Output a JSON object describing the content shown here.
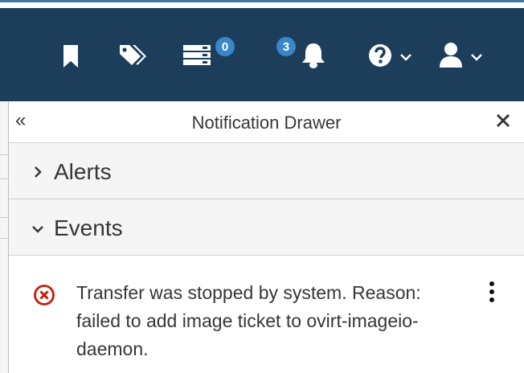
{
  "navbar": {
    "items": [
      {
        "icon": "bookmark-icon"
      },
      {
        "icon": "tags-icon"
      },
      {
        "icon": "tasks-icon",
        "badge": "0"
      },
      {
        "icon": "bell-icon",
        "badge": "3"
      },
      {
        "icon": "help-icon"
      },
      {
        "icon": "user-icon"
      }
    ]
  },
  "drawer": {
    "title": "Notification Drawer",
    "expand_glyph": "«",
    "sections": [
      {
        "label": "Alerts",
        "expanded": false
      },
      {
        "label": "Events",
        "expanded": true
      }
    ],
    "events": [
      {
        "message": "Transfer was stopped by system. Reason: failed to add image ticket to ovirt-imageio-daemon.",
        "severity": "error"
      }
    ]
  },
  "colors": {
    "navbar": "#1c3e5b",
    "badge": "#3a86c8",
    "error": "#c9190b"
  }
}
